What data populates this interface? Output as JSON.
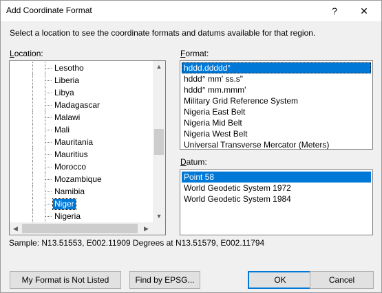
{
  "window": {
    "title": "Add Coordinate Format",
    "help_glyph": "?",
    "close_glyph": "✕"
  },
  "instruction": "Select a location to see the coordinate formats and datums available for that region.",
  "location": {
    "label": "Location:",
    "mnemonic": "L",
    "label_rest": "ocation:",
    "items": [
      "Lesotho",
      "Liberia",
      "Libya",
      "Madagascar",
      "Malawi",
      "Mali",
      "Mauritania",
      "Mauritius",
      "Morocco",
      "Mozambique",
      "Namibia",
      "Niger",
      "Nigeria"
    ],
    "selected": "Niger",
    "scroll_up_glyph": "▲",
    "scroll_down_glyph": "▼",
    "scroll_left_glyph": "◀",
    "scroll_right_glyph": "▶"
  },
  "format": {
    "label": "Format:",
    "mnemonic": "F",
    "label_rest": "ormat:",
    "items": [
      "hddd.ddddd°",
      "hddd° mm' ss.s\"",
      "hddd° mm.mmm'",
      "Military Grid Reference System",
      "Nigeria East Belt",
      "Nigeria Mid Belt",
      "Nigeria West Belt",
      "Universal Transverse Mercator (Meters)"
    ],
    "selected": "hddd.ddddd°"
  },
  "datum": {
    "label": "Datum:",
    "mnemonic": "D",
    "label_rest": "atum:",
    "items": [
      "Point 58",
      "World Geodetic System 1972",
      "World Geodetic System 1984"
    ],
    "selected": "Point 58"
  },
  "sample": "Sample: N13.51553, E002.11909 Degrees at N13.51579, E002.11794",
  "buttons": {
    "not_listed": "My Format is Not Listed",
    "find_epsg": "Find by EPSG...",
    "ok": "OK",
    "cancel": "Cancel"
  },
  "colors": {
    "selection": "#0078d7",
    "dialog_bg": "#f0f0f0",
    "button_bg": "#e1e1e1"
  }
}
